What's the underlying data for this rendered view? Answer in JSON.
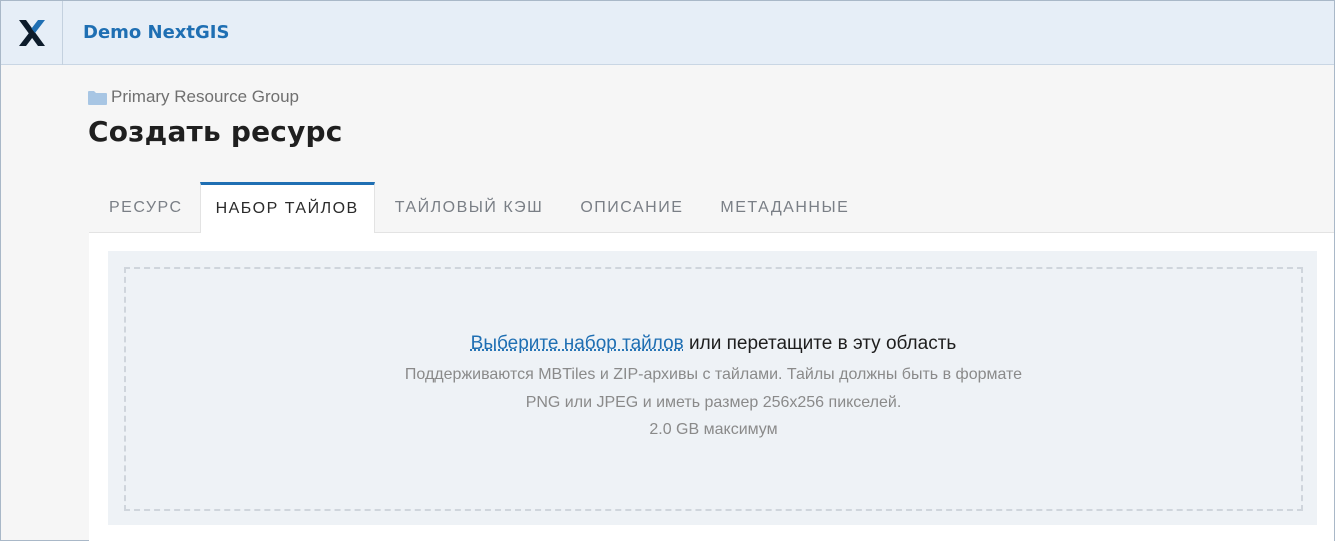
{
  "header": {
    "app_title": "Demo NextGIS",
    "logo_icon": "nextgis-logo-icon"
  },
  "breadcrumb": {
    "icon": "folder-icon",
    "label": "Primary Resource Group"
  },
  "page": {
    "title": "Создать ресурс"
  },
  "tabs": [
    {
      "label": "Ресурс",
      "active": false
    },
    {
      "label": "Набор тайлов",
      "active": true
    },
    {
      "label": "Тайловый кэш",
      "active": false
    },
    {
      "label": "Описание",
      "active": false
    },
    {
      "label": "Метаданные",
      "active": false
    }
  ],
  "dropzone": {
    "link_text": "Выберите набор тайлов",
    "main_text": " или перетащите в эту область",
    "hint_line1": "Поддерживаются MBTiles и ZIP-архивы с тайлами. Тайлы должны быть в формате",
    "hint_line2": "PNG или JPEG и иметь размер 256x256 пикселей.",
    "hint_line3": "2.0 GB максимум"
  },
  "colors": {
    "accent": "#1f6fb3",
    "header_bg": "#e6eef7",
    "dropzone_bg": "#eef2f6"
  }
}
